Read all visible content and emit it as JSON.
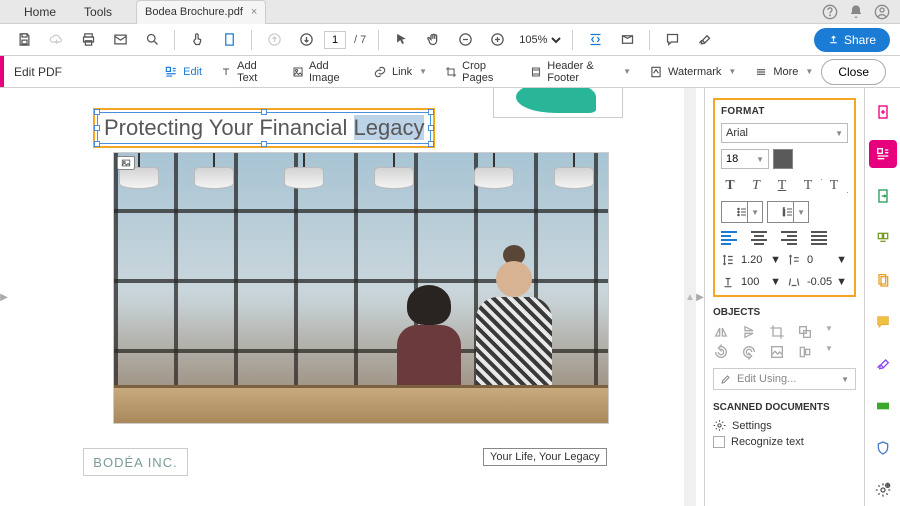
{
  "menubar": {
    "home": "Home",
    "tools": "Tools",
    "tabs": [
      {
        "title": "Bodea Brochure.pdf"
      }
    ]
  },
  "toolbar": {
    "page_current": "1",
    "page_total": "/ 7",
    "zoom": "105%",
    "share_label": "Share"
  },
  "edit_toolbar": {
    "title": "Edit PDF",
    "edit": "Edit",
    "add_text": "Add Text",
    "add_image": "Add Image",
    "link": "Link",
    "crop_pages": "Crop Pages",
    "header_footer": "Header & Footer",
    "watermark": "Watermark",
    "more": "More",
    "close": "Close"
  },
  "document": {
    "heading_prefix": "Protecting Your Financial ",
    "heading_highlight": "Legacy",
    "logo": "BODÉA INC.",
    "tagline": "Your Life, Your Legacy"
  },
  "format_panel": {
    "title": "FORMAT",
    "font": "Arial",
    "size": "18",
    "line_spacing": "1.20",
    "para_spacing": "0",
    "h_scale": "100",
    "char_spacing": "-0.05"
  },
  "objects_panel": {
    "title": "OBJECTS",
    "edit_using": "Edit Using..."
  },
  "scanned_panel": {
    "title": "SCANNED DOCUMENTS",
    "settings": "Settings",
    "recognize": "Recognize text"
  }
}
